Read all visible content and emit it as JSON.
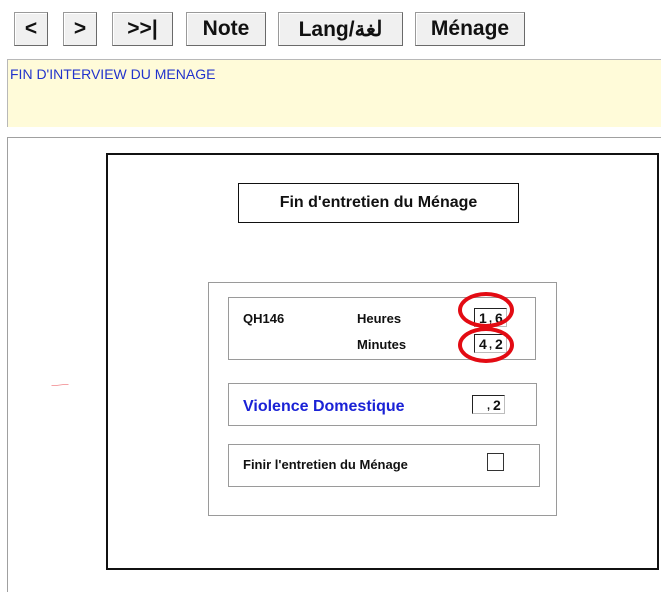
{
  "toolbar": {
    "prev": "<",
    "next": ">",
    "last": ">>|",
    "note": "Note",
    "lang": "Lang/لغة",
    "menage": "Ménage"
  },
  "banner": {
    "text": "FIN D'INTERVIEW DU MENAGE"
  },
  "form": {
    "title": "Fin d'entretien du Ménage",
    "question_id": "QH146",
    "hours_label": "Heures",
    "hours_digits": [
      "1",
      "6"
    ],
    "minutes_label": "Minutes",
    "minutes_digits": [
      "4",
      "2"
    ],
    "violence_label": "Violence Domestique",
    "violence_value": "2",
    "finish_label": "Finir l'entretien du Ménage",
    "finish_value": ""
  },
  "colors": {
    "banner_bg": "#fffbd9",
    "banner_text": "#2233cc",
    "violence_text": "#1a22d6",
    "highlight_circle": "#e30b13"
  }
}
